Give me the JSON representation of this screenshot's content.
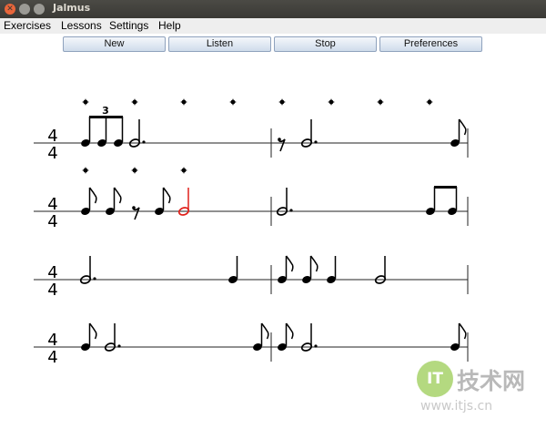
{
  "window": {
    "title": "Jalmus"
  },
  "menu": [
    "Exercises",
    "Lessons",
    "Settings",
    "Help"
  ],
  "toolbar": {
    "new_label": "New",
    "listen_label": "Listen",
    "stop_label": "Stop",
    "preferences_label": "Preferences"
  },
  "score": {
    "time_signature": {
      "top": "4",
      "bottom": "4"
    },
    "triplet_label": "3",
    "highlight_color": "#e0201a",
    "note_color": "#000000",
    "systems": [
      {
        "beats_shown": 8
      },
      {
        "beats_shown": 3,
        "highlighted_note": "half note"
      },
      {
        "beats_shown": 0
      },
      {
        "beats_shown": 0
      }
    ]
  },
  "watermark": {
    "logo_text": "IT",
    "brand": "技术网",
    "url": "www.itjs.cn"
  }
}
